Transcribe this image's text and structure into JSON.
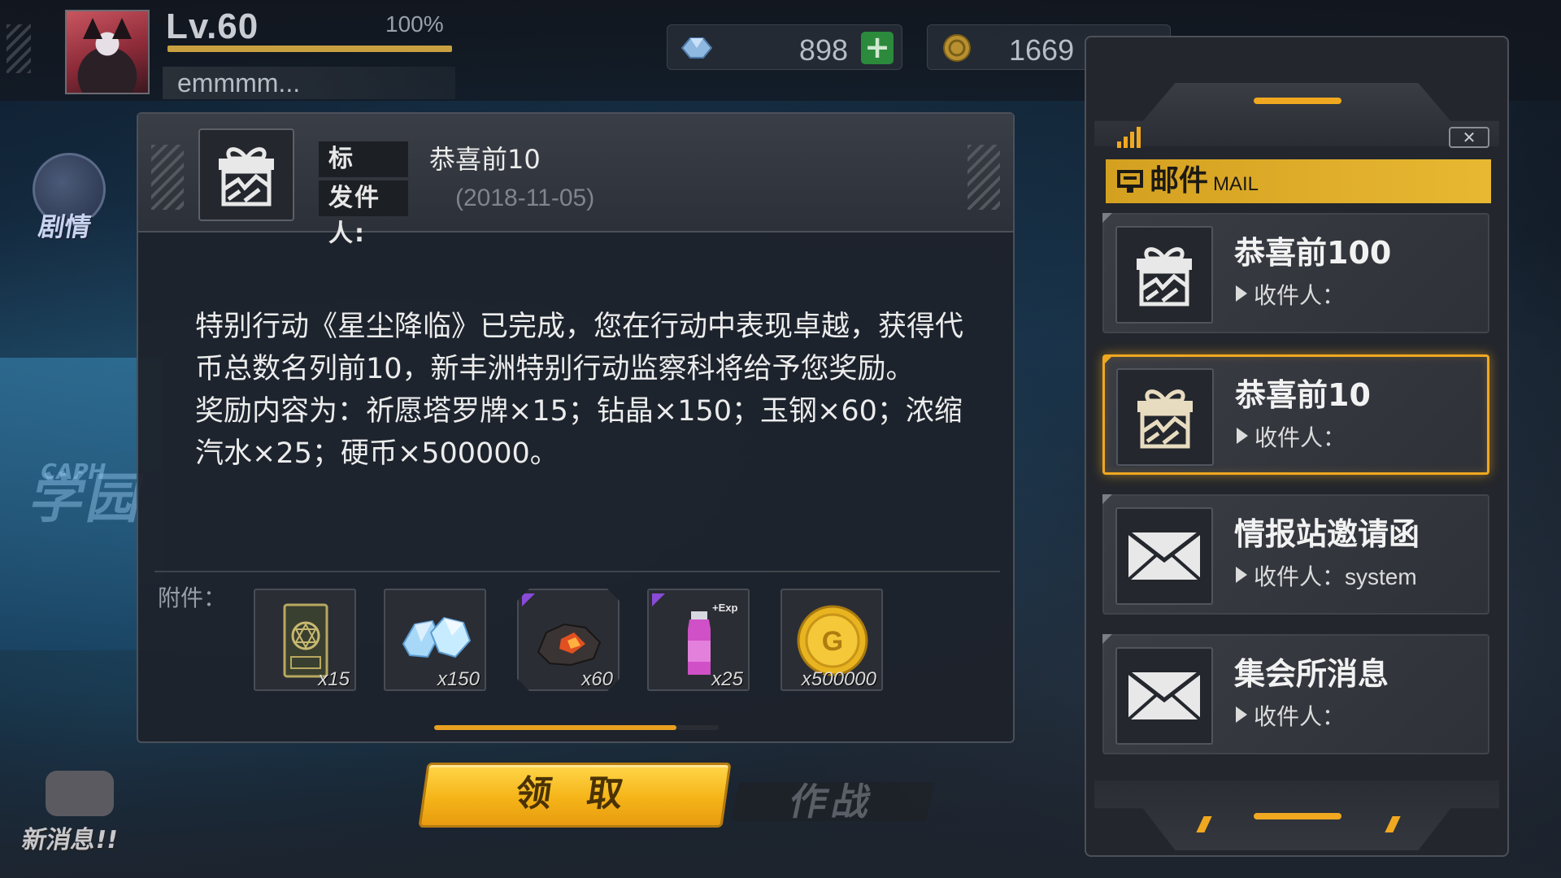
{
  "player": {
    "level": "Lv.60",
    "exp_percent": "100%",
    "exp_fraction": 1.0,
    "name": "emmmm..."
  },
  "resources": {
    "crystal_value": "898",
    "coin_value": "1669"
  },
  "side_buttons": {
    "story_label": "剧情",
    "news_label": "新消息!!"
  },
  "mail_detail": {
    "title_label": "标　题:",
    "subject": "恭喜前10",
    "sender_label": "发件人:",
    "date": "(2018-11-05)",
    "body_paragraph_1": "特别行动《星尘降临》已完成，您在行动中表现卓越，获得代币总数名列前10，新丰洲特别行动监察科将给予您奖励。",
    "body_paragraph_2": "奖励内容为：祈愿塔罗牌×15；钻晶×150；玉钢×60；浓缩汽水×25；硬币×500000。",
    "attachments_label": "附件：",
    "attachments": [
      {
        "name": "tarot-card",
        "count": "x15",
        "icon": "tarot-card-icon"
      },
      {
        "name": "crystal",
        "count": "x150",
        "icon": "crystal-icon"
      },
      {
        "name": "jade-steel",
        "count": "x60",
        "icon": "ore-icon"
      },
      {
        "name": "soda",
        "count": "x25",
        "icon": "soda-bottle-icon",
        "badge": "+Exp"
      },
      {
        "name": "coin",
        "count": "x500000",
        "icon": "coin-icon"
      }
    ],
    "attachment_scroll_fraction": 0.85
  },
  "actions": {
    "claim_label": "领 取",
    "battle_label": "作战"
  },
  "mail_list": {
    "header_zh": "邮件",
    "header_en": "MAIL",
    "close_label": "✕",
    "items": [
      {
        "title": "恭喜前100",
        "recipient_label": "收件人：",
        "recipient": "",
        "icon": "gift-icon",
        "selected": false
      },
      {
        "title": "恭喜前10",
        "recipient_label": "收件人：",
        "recipient": "",
        "icon": "gift-icon",
        "selected": true
      },
      {
        "title": "情报站邀请函",
        "recipient_label": "收件人：",
        "recipient": "system",
        "icon": "envelope-icon",
        "selected": false
      },
      {
        "title": "集会所消息",
        "recipient_label": "收件人：",
        "recipient": "",
        "icon": "envelope-icon",
        "selected": false
      }
    ]
  },
  "colors": {
    "accent": "#f0a820",
    "panel": "#23262c",
    "claim_button": "#f5b418"
  }
}
